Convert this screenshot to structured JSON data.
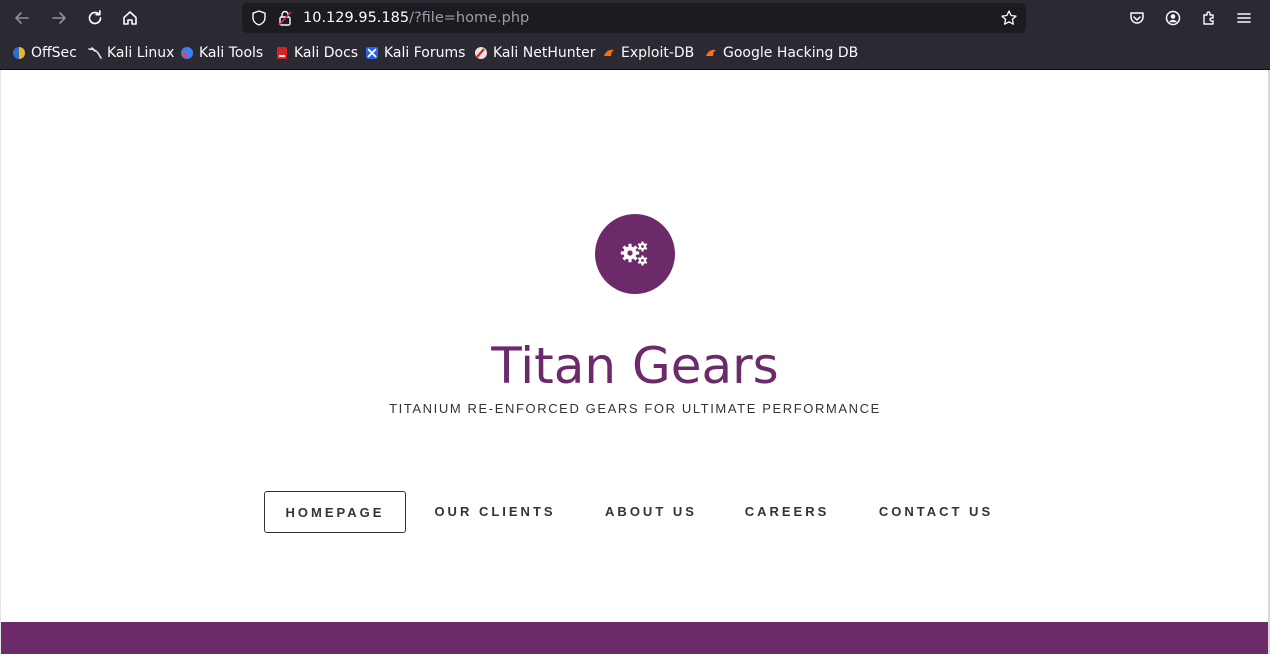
{
  "browser": {
    "url_host": "10.129.95.185",
    "url_path": "/?file=home.php",
    "bookmarks": [
      {
        "label": "OffSec",
        "icon": "offsec-icon"
      },
      {
        "label": "Kali Linux",
        "icon": "kali-dragon-icon"
      },
      {
        "label": "Kali Tools",
        "icon": "kali-tools-icon"
      },
      {
        "label": "Kali Docs",
        "icon": "kali-docs-icon"
      },
      {
        "label": "Kali Forums",
        "icon": "kali-forums-icon"
      },
      {
        "label": "Kali NetHunter",
        "icon": "nethunter-icon"
      },
      {
        "label": "Exploit-DB",
        "icon": "exploitdb-icon"
      },
      {
        "label": "Google Hacking DB",
        "icon": "ghdb-icon"
      }
    ]
  },
  "site": {
    "logo_icon": "gears-icon",
    "title": "Titan Gears",
    "tagline": "TITANIUM RE-ENFORCED GEARS FOR ULTIMATE PERFORMANCE",
    "nav": [
      {
        "label": "HOMEPAGE",
        "active": true
      },
      {
        "label": "OUR CLIENTS",
        "active": false
      },
      {
        "label": "ABOUT US",
        "active": false
      },
      {
        "label": "CAREERS",
        "active": false
      },
      {
        "label": "CONTACT US",
        "active": false
      }
    ]
  },
  "colors": {
    "brand": "#6c2a6a",
    "chrome": "#2b2a33",
    "urlbar": "#1c1b22",
    "text": "#333333"
  }
}
